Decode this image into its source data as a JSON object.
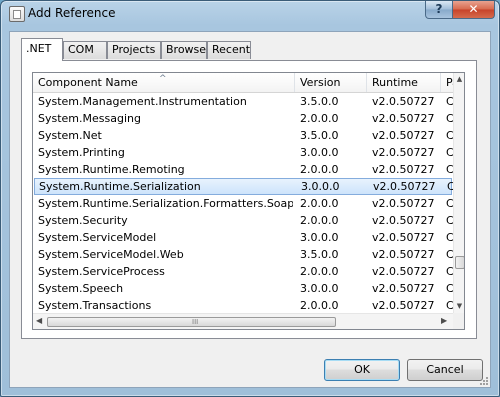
{
  "window": {
    "title": "Add Reference",
    "help_label": "?",
    "close_label": "✕"
  },
  "tabs": [
    {
      "label": ".NET",
      "active": true
    },
    {
      "label": "COM",
      "active": false
    },
    {
      "label": "Projects",
      "active": false
    },
    {
      "label": "Browse",
      "active": false
    },
    {
      "label": "Recent",
      "active": false
    }
  ],
  "list": {
    "columns": [
      "Component Name",
      "Version",
      "Runtime",
      "Pa"
    ],
    "sort_glyph": "^",
    "rows": [
      {
        "name": "System.Management.Instrumentation",
        "version": "3.5.0.0",
        "runtime": "v2.0.50727",
        "path": "C:"
      },
      {
        "name": "System.Messaging",
        "version": "2.0.0.0",
        "runtime": "v2.0.50727",
        "path": "C:"
      },
      {
        "name": "System.Net",
        "version": "3.5.0.0",
        "runtime": "v2.0.50727",
        "path": "C:"
      },
      {
        "name": "System.Printing",
        "version": "3.0.0.0",
        "runtime": "v2.0.50727",
        "path": "C:"
      },
      {
        "name": "System.Runtime.Remoting",
        "version": "2.0.0.0",
        "runtime": "v2.0.50727",
        "path": "C:"
      },
      {
        "name": "System.Runtime.Serialization",
        "version": "3.0.0.0",
        "runtime": "v2.0.50727",
        "path": "C:"
      },
      {
        "name": "System.Runtime.Serialization.Formatters.Soap",
        "version": "2.0.0.0",
        "runtime": "v2.0.50727",
        "path": "C:"
      },
      {
        "name": "System.Security",
        "version": "2.0.0.0",
        "runtime": "v2.0.50727",
        "path": "C:"
      },
      {
        "name": "System.ServiceModel",
        "version": "3.0.0.0",
        "runtime": "v2.0.50727",
        "path": "C:"
      },
      {
        "name": "System.ServiceModel.Web",
        "version": "3.5.0.0",
        "runtime": "v2.0.50727",
        "path": "C:"
      },
      {
        "name": "System.ServiceProcess",
        "version": "2.0.0.0",
        "runtime": "v2.0.50727",
        "path": "C:"
      },
      {
        "name": "System.Speech",
        "version": "3.0.0.0",
        "runtime": "v2.0.50727",
        "path": "C:"
      },
      {
        "name": "System.Transactions",
        "version": "2.0.0.0",
        "runtime": "v2.0.50727",
        "path": "C:"
      }
    ],
    "selected_index": 5,
    "hscroll_grip": "III"
  },
  "buttons": {
    "ok": "OK",
    "cancel": "Cancel"
  },
  "colors": {
    "selection": "#cde4fb",
    "selection_border": "#84acdd",
    "title_gradient": "#b9d3e8",
    "close": "#c7432a"
  }
}
